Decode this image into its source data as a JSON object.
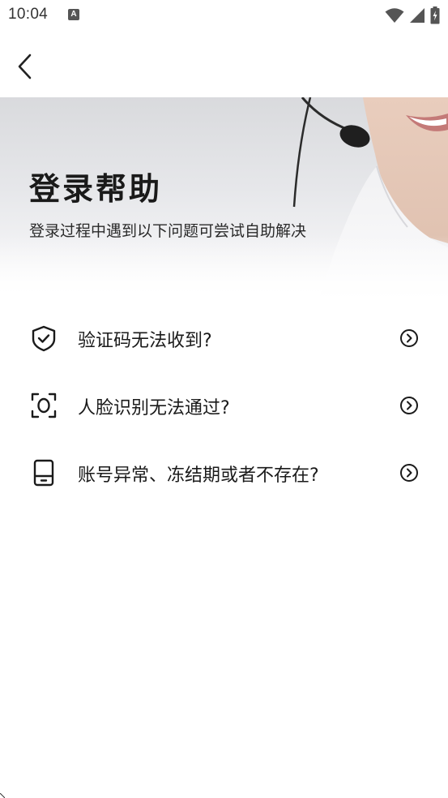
{
  "status_bar": {
    "time": "10:04",
    "notification_icon_letter": "A",
    "icons": [
      "wifi-icon",
      "signal-icon",
      "battery-charging-icon"
    ]
  },
  "nav": {
    "back_icon": "chevron-left-icon"
  },
  "hero": {
    "title": "登录帮助",
    "subtitle": "登录过程中遇到以下问题可尝试自助解决"
  },
  "help_items": [
    {
      "label": "验证码无法收到?",
      "icon": "shield-check-icon"
    },
    {
      "label": "人脸识别无法通过?",
      "icon": "face-scan-icon"
    },
    {
      "label": "账号异常、冻结期或者不存在?",
      "icon": "phone-icon"
    }
  ],
  "colors": {
    "text_primary": "#1a1a1a",
    "background": "#ffffff",
    "hero_gray": "#dcdde0"
  }
}
